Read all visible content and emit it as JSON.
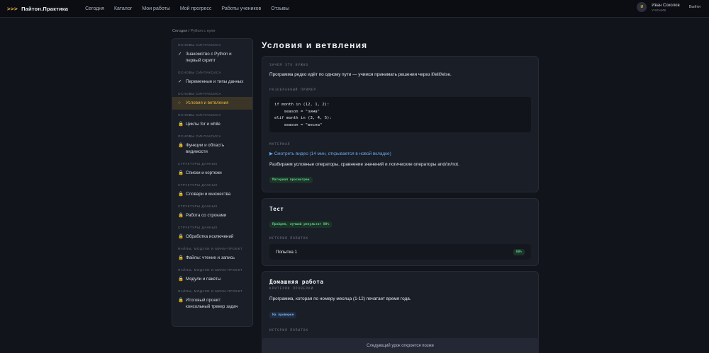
{
  "header": {
    "logo_mark": ">>>",
    "logo_text": "Пайтон.Практика",
    "nav": [
      "Сегодня",
      "Каталог",
      "Мои работы",
      "Мой прогресс",
      "Работы учеников",
      "Отзывы"
    ],
    "user_initial": "И",
    "user_name": "Иван Соколов",
    "user_role": "УЧЕНИК",
    "logout": "Выйти"
  },
  "breadcrumb": {
    "root": "Сегодня",
    "sep": " / ",
    "current": "Python с нуля"
  },
  "sidebar": [
    {
      "section": "Основы синтаксиса",
      "label": "Знакомство с Python и первый скрипт",
      "state": "done",
      "mark": "✓"
    },
    {
      "section": "Основы синтаксиса",
      "label": "Переменные и типы данных",
      "state": "done",
      "mark": "✓"
    },
    {
      "section": "Основы синтаксиса",
      "label": "Условия и ветвления",
      "state": "active",
      "mark": "○"
    },
    {
      "section": "Основы синтаксиса",
      "label": "Циклы for и while",
      "state": "locked",
      "mark": "🔒"
    },
    {
      "section": "Основы синтаксиса",
      "label": "Функции и область видимости",
      "state": "locked",
      "mark": "🔒"
    },
    {
      "section": "Структуры данных",
      "label": "Списки и кортежи",
      "state": "locked",
      "mark": "🔒"
    },
    {
      "section": "Структуры данных",
      "label": "Словари и множества",
      "state": "locked",
      "mark": "🔒"
    },
    {
      "section": "Структуры данных",
      "label": "Работа со строками",
      "state": "locked",
      "mark": "🔒"
    },
    {
      "section": "Структуры данных",
      "label": "Обработка исключений",
      "state": "locked",
      "mark": "🔒"
    },
    {
      "section": "Файлы, модули и мини-проект",
      "label": "Файлы: чтение и запись",
      "state": "locked",
      "mark": "🔒"
    },
    {
      "section": "Файлы, модули и мини-проект",
      "label": "Модули и пакеты",
      "state": "locked",
      "mark": "🔒"
    },
    {
      "section": "Файлы, модули и мини-проект",
      "label": "Итоговый проект: консольный трекер задач",
      "state": "locked",
      "mark": "🔒"
    }
  ],
  "lesson": {
    "title": "Условия и ветвления",
    "why_label": "Зачем это нужно",
    "why_text": "Программа редко идёт по одному пути — учимся принимать решения через if/elif/else.",
    "example_label": "Разобранный пример",
    "code": "if month in (12, 1, 2):\n    season = \"зима\"\nelif month in (3, 4, 5):\n    season = \"весна\"",
    "material_label": "Материал",
    "video_link": "▶ Смотреть видео (14 мин, открывается в новой вкладке)",
    "material_text": "Разбираем условные операторы, сравнение значений и логические операторы and/or/not.",
    "material_badge": "Материал просмотрен"
  },
  "test": {
    "title": "Тест",
    "badge": "Пройден, лучший результат 88%",
    "history_label": "История попыток",
    "attempts": [
      {
        "name": "Попытка 1",
        "score": "88%"
      }
    ]
  },
  "homework": {
    "title": "Домашняя работа",
    "criteria_label": "Критерии проверки",
    "criteria_text": "Программа, которая по номеру месяца (1-12) печатает время года.",
    "badge": "На проверке",
    "history_label": "История попыток"
  },
  "footer": {
    "text": "Следующий урок откроется позже"
  },
  "colors": {
    "accent": "#e3b341",
    "link": "#6aa6e8",
    "success": "#5bd08e",
    "bg": "#11141a"
  }
}
